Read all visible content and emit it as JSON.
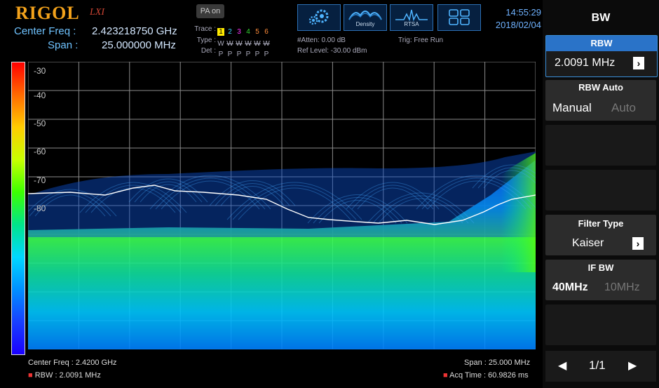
{
  "brand": {
    "logo": "RIGOL",
    "logo_sub": "LXI"
  },
  "header": {
    "pa_button": "PA on",
    "center_freq_label": "Center Freq :",
    "center_freq_value": "2.423218750 GHz",
    "span_label": "Span :",
    "span_value": "25.000000 MHz",
    "trace_label": "Trace :",
    "type_label": "Type :",
    "det_label": "Det :",
    "traces": [
      "1",
      "2",
      "3",
      "4",
      "5",
      "6"
    ],
    "trace_colors": [
      "#ffea00",
      "#3cd7ff",
      "#ff33ff",
      "#34d934",
      "#ff8c3a",
      "#ff8c3a"
    ],
    "types": [
      "W",
      "W",
      "W",
      "W",
      "W",
      "W"
    ],
    "dets": [
      "P",
      "P",
      "P",
      "P",
      "P",
      "P"
    ],
    "atten": "#Atten: 0.00 dB",
    "ref_level": "Ref Level: -30.00 dBm",
    "trig": "Trig: Free Run",
    "mode_buttons": [
      {
        "name": "settings",
        "label": "",
        "icon": "gears-icon"
      },
      {
        "name": "density",
        "label": "Density",
        "icon": "density-icon"
      },
      {
        "name": "rtsa",
        "label": "RTSA",
        "icon": "rtsa-icon"
      },
      {
        "name": "layout",
        "label": "",
        "icon": "grid-layout-icon"
      }
    ],
    "time": "14:55:29",
    "date": "2018/02/04"
  },
  "plot": {
    "y_labels": [
      "-30",
      "-40",
      "-50",
      "-60",
      "-70",
      "-80"
    ],
    "colors": {
      "grid": "#8a8a8a",
      "trace": "#ffffff",
      "density_high": "#5cff00",
      "density_low": "#00b4ff"
    }
  },
  "footer": {
    "center_freq": "Center Freq : 2.4200 GHz",
    "rbw": "RBW : 2.0091 MHz",
    "span": "Span : 25.000 MHz",
    "acq_time": "Acq Time : 60.9826 ms"
  },
  "side_panel": {
    "title": "BW",
    "rbw_title": "RBW",
    "rbw_value": "2.0091 MHz",
    "rbw_auto_title": "RBW Auto",
    "rbw_auto_options": [
      "Manual",
      "Auto"
    ],
    "filter_type_title": "Filter Type",
    "filter_type_value": "Kaiser",
    "if_bw_title": "IF BW",
    "if_bw_options": [
      "40MHz",
      "10MHz"
    ],
    "page": "1/1"
  }
}
